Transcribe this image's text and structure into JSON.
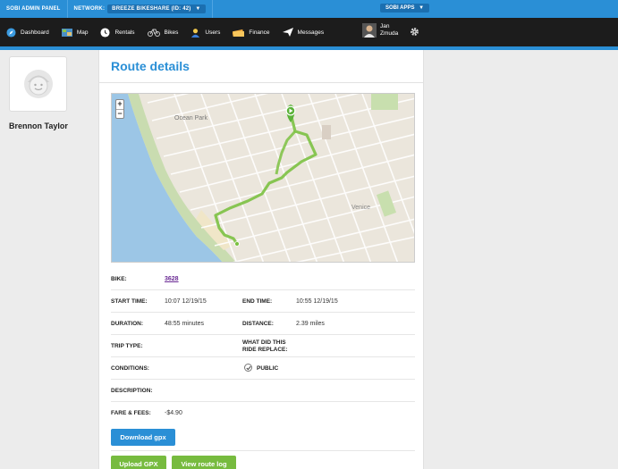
{
  "topbar": {
    "admin_panel": "SOBI ADMIN PANEL",
    "network_label": "NETWORK:",
    "network_value": "BREEZE BIKESHARE (ID: 42)",
    "network_caret": "▼",
    "apps": "SOBI APPS",
    "apps_caret": "▼"
  },
  "nav": {
    "items": [
      {
        "label": "Dashboard",
        "icon": "compass-icon"
      },
      {
        "label": "Map",
        "icon": "map-icon"
      },
      {
        "label": "Rentals",
        "icon": "clock-icon"
      },
      {
        "label": "Bikes",
        "icon": "bike-icon"
      },
      {
        "label": "Users",
        "icon": "user-icon"
      },
      {
        "label": "Finance",
        "icon": "money-icon"
      },
      {
        "label": "Messages",
        "icon": "paper-plane-icon"
      }
    ],
    "user_first": "Jan",
    "user_last": "Zmuda"
  },
  "profile": {
    "name": "Brennon Taylor"
  },
  "route": {
    "title": "Route details",
    "map_labels": {
      "ocean_park": "Ocean Park",
      "venice": "Venice"
    },
    "bike_label": "BIKE:",
    "bike_value": "3628",
    "start_label": "START TIME:",
    "start_value": "10:07 12/19/15",
    "end_label": "END TIME:",
    "end_value": "10:55 12/19/15",
    "duration_label": "DURATION:",
    "duration_value": "48:55 minutes",
    "distance_label": "DISTANCE:",
    "distance_value": "2.39 miles",
    "trip_type_label": "TRIP TYPE:",
    "replace_label_1": "WHAT DID THIS",
    "replace_label_2": "RIDE REPLACE:",
    "conditions_label": "CONDITIONS:",
    "public_label": "PUBLIC",
    "public_checked": true,
    "description_label": "DESCRIPTION:",
    "fare_label": "FARE & FEES:",
    "fare_value": "-$4.90"
  },
  "buttons": {
    "download_gpx": "Download gpx",
    "upload_gpx": "Upload GPX",
    "view_log": "View route log"
  },
  "colors": {
    "brand_blue": "#2a8fd6",
    "nav_dark": "#1c1c1c",
    "route_green": "#77bb3f",
    "link_purple": "#6a2a94"
  }
}
